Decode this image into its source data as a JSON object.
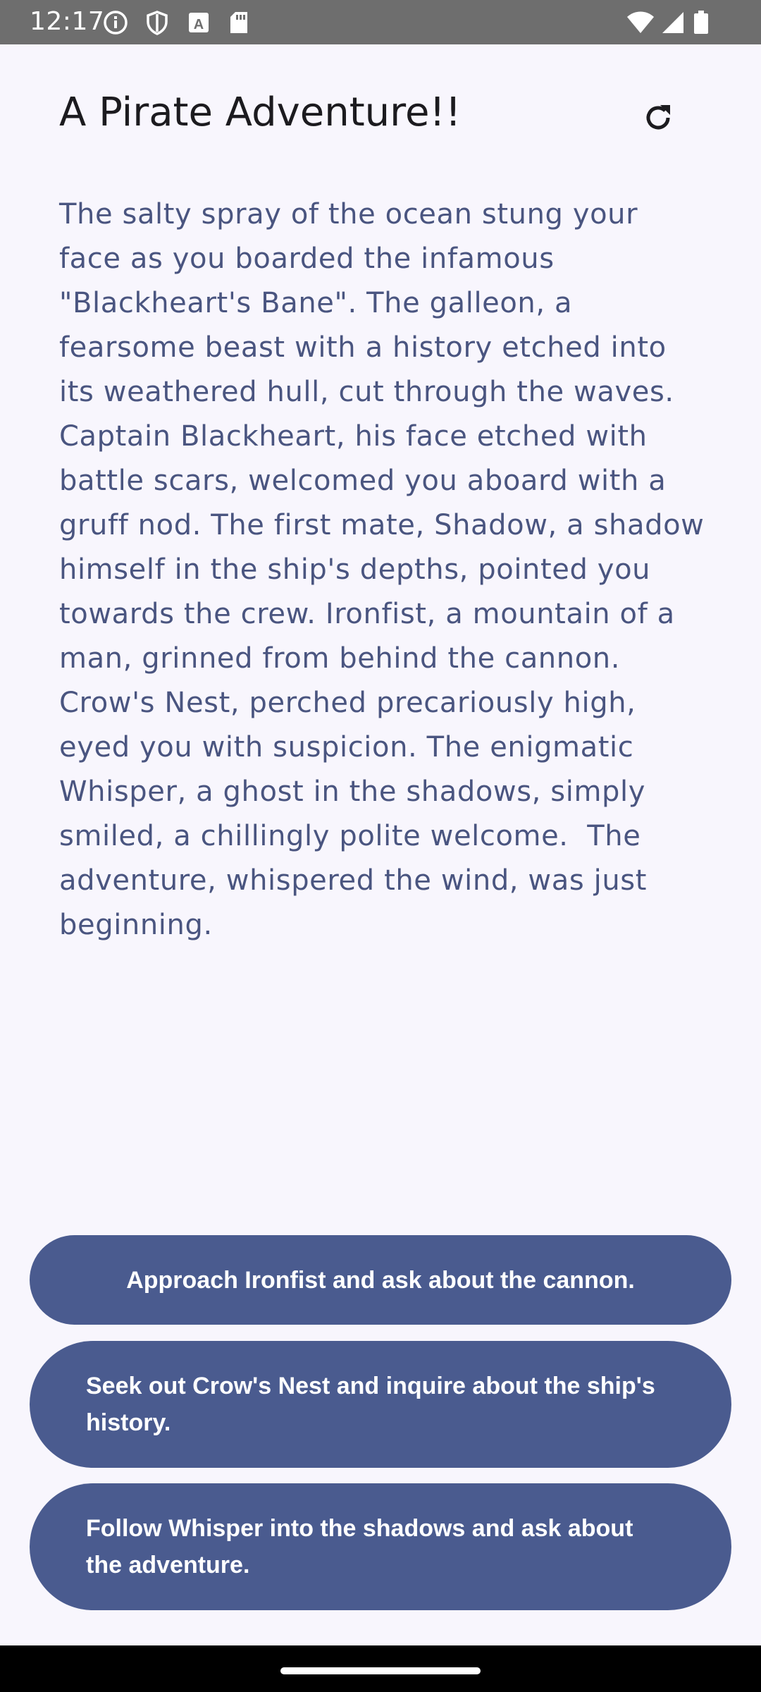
{
  "status_bar": {
    "time": "12:17",
    "left_icons": [
      "info-icon",
      "shield-icon",
      "a-box-icon",
      "sd-card-icon"
    ],
    "right_icons": [
      "wifi-icon",
      "cell-signal-icon",
      "battery-icon"
    ]
  },
  "header": {
    "title": "A Pirate Adventure!!",
    "refresh_icon": "refresh-icon"
  },
  "story": {
    "text": "The salty spray of the ocean stung your face as you boarded the infamous \"Blackheart's Bane\". The galleon, a fearsome beast with a history etched into its weathered hull, cut through the waves.  Captain Blackheart, his face etched with battle scars, welcomed you aboard with a gruff nod. The first mate, Shadow, a shadow himself in the ship's depths, pointed you towards the crew. Ironfist, a mountain of a man, grinned from behind the cannon. Crow's Nest, perched precariously high, eyed you with suspicion. The enigmatic Whisper, a ghost in the shadows, simply smiled, a chillingly polite welcome.  The adventure, whispered the wind, was just beginning."
  },
  "choices": [
    {
      "label": "Approach Ironfist and ask about the cannon."
    },
    {
      "label": "Seek out Crow's Nest and inquire about the ship's history."
    },
    {
      "label": "Follow Whisper into the shadows and ask about the adventure."
    }
  ],
  "colors": {
    "background": "#f8f6fd",
    "story_text": "#4a5580",
    "button": "#4a5b8f",
    "status_bar": "#6e6e6e"
  }
}
